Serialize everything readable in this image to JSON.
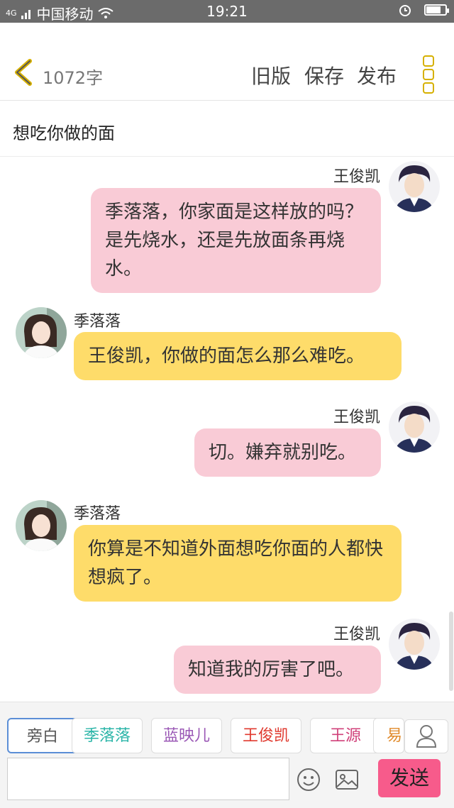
{
  "statusbar": {
    "signal": "4G",
    "carrier": "中国移动",
    "time": "19:21"
  },
  "header": {
    "word_count": "1072字",
    "old_version": "旧版",
    "save": "保存",
    "publish": "发布"
  },
  "title": "想吃你做的面",
  "messages": [
    {
      "speaker": "王俊凯",
      "text": "季落落，你家面是这样放的吗？是先烧水，还是先放面条再烧水。"
    },
    {
      "speaker": "季落落",
      "text": "王俊凯，你做的面怎么那么难吃。"
    },
    {
      "speaker": "王俊凯",
      "text": "切。嫌弃就别吃。"
    },
    {
      "speaker": "季落落",
      "text": "你算是不知道外面想吃你面的人都快想疯了。"
    },
    {
      "speaker": "王俊凯",
      "text": "知道我的厉害了吧。"
    }
  ],
  "roles": [
    {
      "label": "旁白",
      "color": "#555555"
    },
    {
      "label": "季落落",
      "color": "#2bb5a8"
    },
    {
      "label": "蓝映儿",
      "color": "#9b59b6"
    },
    {
      "label": "王俊凯",
      "color": "#e03a2f"
    },
    {
      "label": "王源",
      "color": "#d0417a"
    },
    {
      "label": "易",
      "color": "#e08a2b"
    }
  ],
  "input": {
    "placeholder": ""
  },
  "send_label": "发送",
  "colors": {
    "pink_bubble": "#f9cbd6",
    "yellow_bubble": "#fedc6a",
    "send": "#f75b8b",
    "accent": "#d6b000"
  }
}
